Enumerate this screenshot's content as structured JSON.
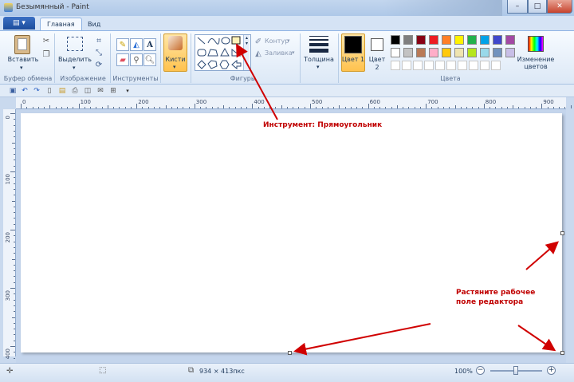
{
  "window": {
    "title": "Безымянный - Paint",
    "minimize": "–",
    "maximize": "□",
    "close": "✕"
  },
  "tabs": [
    {
      "label": "Главная"
    },
    {
      "label": "Вид"
    }
  ],
  "app_menu": "▤ ▾",
  "ribbon": {
    "clipboard": {
      "label": "Буфер обмена",
      "paste": "Вставить"
    },
    "image": {
      "label": "Изображение",
      "select": "Выделить"
    },
    "tools": {
      "label": "Инструменты"
    },
    "brushes": {
      "label": "Кисти"
    },
    "shapes": {
      "label": "Фигуры",
      "outline": "Контур",
      "fill": "Заливка"
    },
    "size": {
      "label": "Толщина"
    },
    "color1": {
      "label": "Цвет 1"
    },
    "color2": {
      "label": "Цвет 2"
    },
    "colors": {
      "label": "Цвета",
      "edit": "Изменение цветов"
    }
  },
  "palette_row1": [
    "#000000",
    "#7f7f7f",
    "#880015",
    "#ed1c24",
    "#ff7f27",
    "#fff200",
    "#22b14c",
    "#00a2e8",
    "#3f48cc",
    "#a349a4"
  ],
  "palette_row2": [
    "#ffffff",
    "#c3c3c3",
    "#b97a57",
    "#ffaec9",
    "#ffc90e",
    "#efe4b0",
    "#b5e61d",
    "#99d9ea",
    "#7092be",
    "#c8bfe7"
  ],
  "ruler": {
    "h_ticks": [
      "0",
      "100",
      "200",
      "300",
      "400",
      "500",
      "600",
      "700",
      "800",
      "900"
    ],
    "v_ticks": [
      "0",
      "100",
      "200",
      "300",
      "400"
    ]
  },
  "status": {
    "dimensions": "934 × 413пкс",
    "zoom": "100%"
  },
  "annotations": {
    "tool": "Инструмент: Прямоугольник",
    "resize_line1": "Растяните рабочее",
    "resize_line2": "поле редактора"
  }
}
